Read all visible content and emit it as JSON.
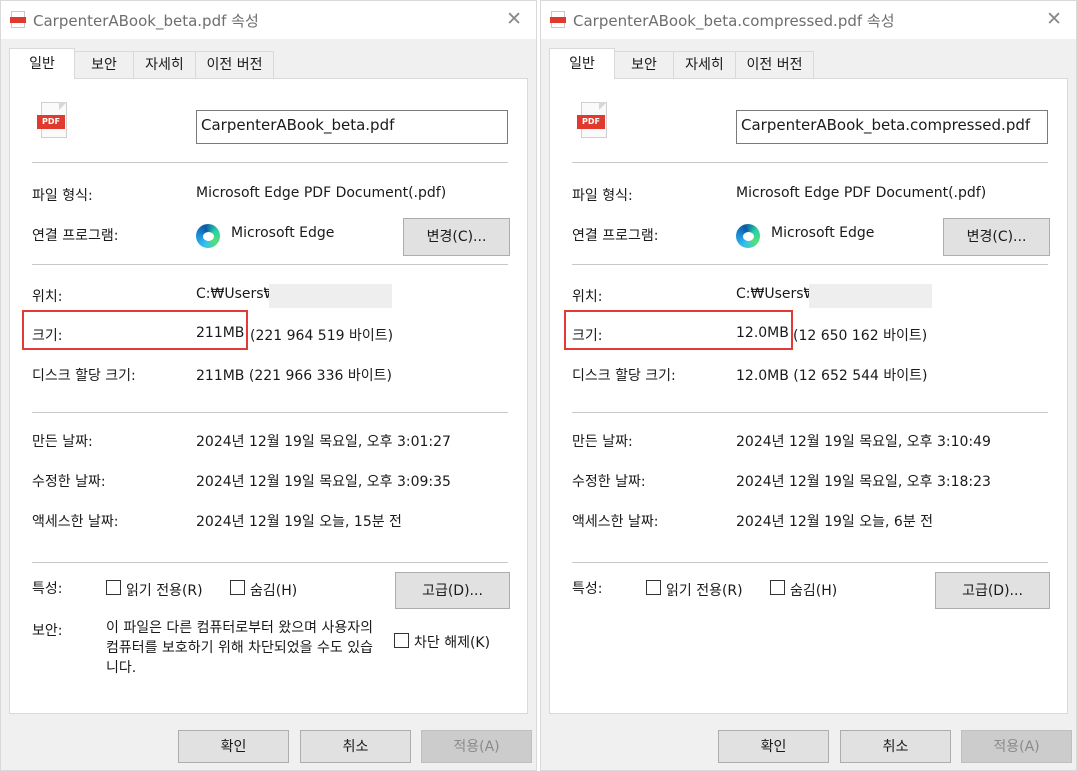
{
  "tabs": [
    "일반",
    "보안",
    "자세히",
    "이전 버전"
  ],
  "labels": {
    "file_type": "파일 형식:",
    "opens_with": "연결 프로그램:",
    "location": "위치:",
    "size": "크기:",
    "size_on_disk": "디스크 할당 크기:",
    "created": "만든 날짜:",
    "modified": "수정한 날짜:",
    "accessed": "액세스한 날짜:",
    "attributes": "특성:",
    "security": "보안:"
  },
  "buttons": {
    "change": "변경(C)...",
    "advanced": "고급(D)...",
    "ok": "확인",
    "cancel": "취소",
    "apply": "적용(A)"
  },
  "checkboxes": {
    "read_only": "읽기 전용(R)",
    "hidden": "숨김(H)",
    "unblock": "차단 해제(K)"
  },
  "icons": {
    "pdf_label": "PDF",
    "title_icon": "pdf-file-icon",
    "app_icon": "edge-icon"
  },
  "colors": {
    "highlight": "#e53935",
    "pdf_red": "#e03a2e"
  },
  "windows": [
    {
      "title": "CarpenterABook_beta.pdf 속성",
      "file_name": "CarpenterABook_beta.pdf",
      "file_type": "Microsoft Edge PDF Document(.pdf)",
      "opens_with": "Microsoft Edge",
      "location": "C:₩Users₩",
      "size": "211MB",
      "size_bytes": "(221 964 519 바이트)",
      "size_on_disk": "211MB (221 966 336 바이트)",
      "created": "2024년 12월 19일 목요일, 오후 3:01:27",
      "modified": "2024년 12월 19일 목요일, 오후 3:09:35",
      "accessed": "2024년 12월 19일 오늘, 15분 전",
      "read_only_checked": false,
      "hidden_checked": false,
      "security_text": "이 파일은 다른 컴퓨터로부터 왔으며 사용자의 컴퓨터를 보호하기 위해 차단되었을 수도 있습니다.",
      "unblock_checked": false
    },
    {
      "title": "CarpenterABook_beta.compressed.pdf 속성",
      "file_name": "CarpenterABook_beta.compressed.pdf",
      "file_type": "Microsoft Edge PDF Document(.pdf)",
      "opens_with": "Microsoft Edge",
      "location": "C:₩Users₩",
      "size": "12.0MB",
      "size_bytes": "(12 650 162 바이트)",
      "size_on_disk": "12.0MB (12 652 544 바이트)",
      "created": "2024년 12월 19일 목요일, 오후 3:10:49",
      "modified": "2024년 12월 19일 목요일, 오후 3:18:23",
      "accessed": "2024년 12월 19일 오늘, 6분 전",
      "read_only_checked": false,
      "hidden_checked": false
    }
  ]
}
